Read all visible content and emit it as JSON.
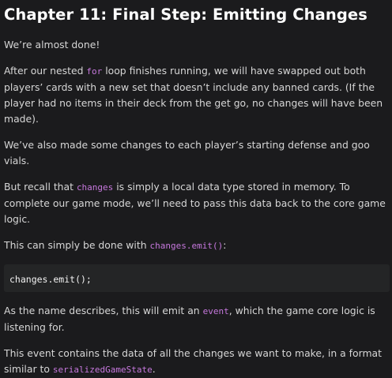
{
  "title": "Chapter 11: Final Step: Emitting Changes",
  "p1": "We’re almost done!",
  "p2": {
    "a": "After our nested ",
    "code": "for",
    "b": " loop finishes running, we will have swapped out both players’ cards with a new set that doesn’t include any banned cards. (If the player had no items in their deck from the get go, no changes will have been made)."
  },
  "p3": "We’ve also made some changes to each player’s starting defense and goo vials.",
  "p4": {
    "a": "But recall that ",
    "code": "changes",
    "b": " is simply a local data type stored in memory. To complete our game mode, we’ll need to pass this data back to the core game logic."
  },
  "p5": {
    "a": "This can simply be done with ",
    "code": "changes.emit()",
    "b": ":"
  },
  "codeblock": "changes.emit();",
  "p6": {
    "a": "As the name describes, this will emit an ",
    "code": "event",
    "b": ", which the game core logic is listening for."
  },
  "p7": {
    "a": "This event contains the data of all the changes we want to make, in a format similar to ",
    "code": "serializedGameState",
    "b": "."
  }
}
